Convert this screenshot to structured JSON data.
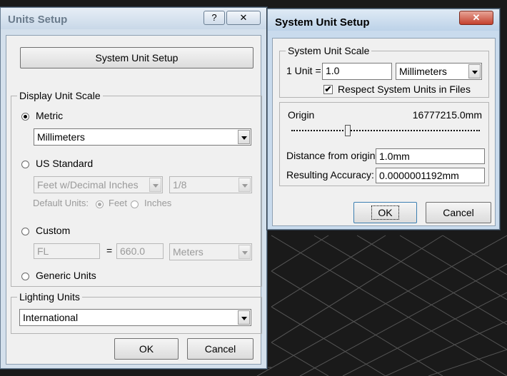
{
  "units_dialog": {
    "title": "Units Setup",
    "help_glyph": "?",
    "close_glyph": "✕",
    "system_unit_setup_button": "System Unit Setup",
    "display_unit_scale": {
      "label": "Display Unit Scale",
      "metric": {
        "label": "Metric",
        "selected": true,
        "value": "Millimeters"
      },
      "us_standard": {
        "label": "US Standard",
        "unit_value": "Feet w/Decimal Inches",
        "fraction_value": "1/8",
        "default_units_label": "Default Units:",
        "feet_label": "Feet",
        "inches_label": "Inches"
      },
      "custom": {
        "label": "Custom",
        "name_value": "FL",
        "equals": "=",
        "amount_value": "660.0",
        "unit_value": "Meters"
      },
      "generic": {
        "label": "Generic Units"
      }
    },
    "lighting_units": {
      "label": "Lighting Units",
      "value": "International"
    },
    "ok_button": "OK",
    "cancel_button": "Cancel"
  },
  "system_dialog": {
    "title": "System Unit Setup",
    "close_glyph": "✕",
    "system_unit_scale": {
      "label": "System Unit Scale",
      "unit_label": "1 Unit =",
      "unit_value": "1.0",
      "unit_type": "Millimeters",
      "respect_checkbox_label": "Respect System Units in Files",
      "respect_checked": true,
      "check_glyph": "✔"
    },
    "origin_label": "Origin",
    "origin_value": "16777215.0mm",
    "slider_position": 0.3,
    "distance_label": "Distance from origin:",
    "distance_value": "1.0mm",
    "accuracy_label": "Resulting Accuracy:",
    "accuracy_value": "0.0000001192mm",
    "ok_button": "OK",
    "cancel_button": "Cancel"
  },
  "colors": {
    "window_frame": "#d4e0ec",
    "client_background": "#f0f0f0",
    "viewport_background": "#1a1a1a",
    "close_button_red": "#c4412d"
  }
}
